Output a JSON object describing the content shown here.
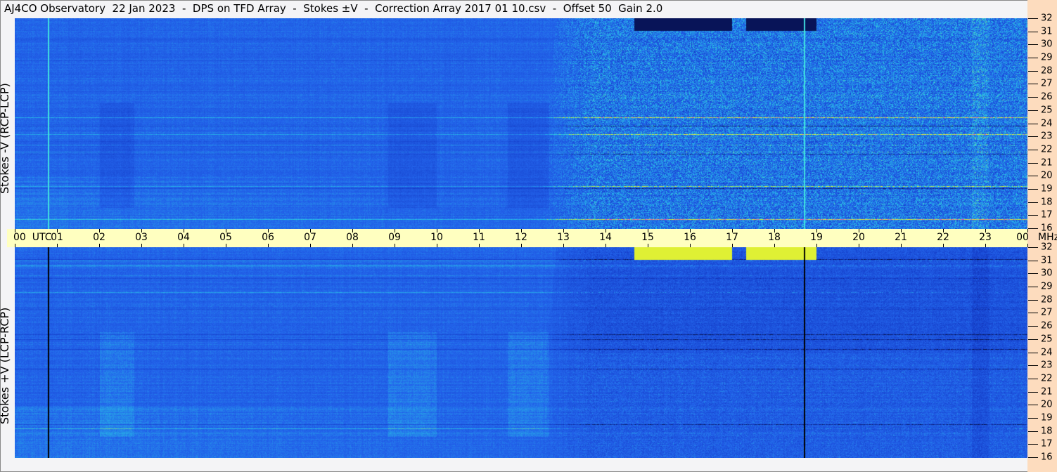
{
  "title": "AJ4CO Observatory  22 Jan 2023  -  DPS on TFD Array  -  Stokes ±V  -  Correction Array 2017 01 10.csv  -  Offset 50  Gain 2.0",
  "colors": {
    "background": "#f4f4f6",
    "axis_strip": "#ffffc0",
    "freq_strip": "#fddcbe",
    "base_blue": "#1f5fe0"
  },
  "chart_data": {
    "type": "heatmap",
    "title": "AJ4CO Observatory  22 Jan 2023  -  DPS on TFD Array  -  Stokes ±V",
    "xlabel": "UTC",
    "ylabel_units": "MHz",
    "x_tick_labels": [
      "00",
      "01",
      "02",
      "03",
      "04",
      "05",
      "06",
      "07",
      "08",
      "09",
      "10",
      "11",
      "12",
      "13",
      "14",
      "15",
      "16",
      "17",
      "18",
      "19",
      "20",
      "21",
      "22",
      "23",
      "00"
    ],
    "x_range_hours": [
      0,
      24
    ],
    "y_tick_labels": [
      "32",
      "31",
      "30",
      "29",
      "28",
      "27",
      "26",
      "25",
      "24",
      "23",
      "22",
      "21",
      "20",
      "19",
      "18",
      "17",
      "16"
    ],
    "y_range_mhz": [
      16,
      32
    ],
    "panels": [
      {
        "name": "Stokes -V (RCP-LCP)",
        "label": "Stokes -V (RCP-LCP)",
        "marker_hours": [
          0.78,
          18.7
        ],
        "marker_color": "#40e0e0"
      },
      {
        "name": "Stokes +V (LCP-RCP)",
        "label": "Stokes +V (LCP-RCP)",
        "marker_hours": [
          0.78,
          18.7
        ],
        "marker_color": "#000000"
      }
    ],
    "activity_onset_hour": 13
  },
  "axis": {
    "utc_label": "UTC",
    "mhz_label": "MHz"
  }
}
